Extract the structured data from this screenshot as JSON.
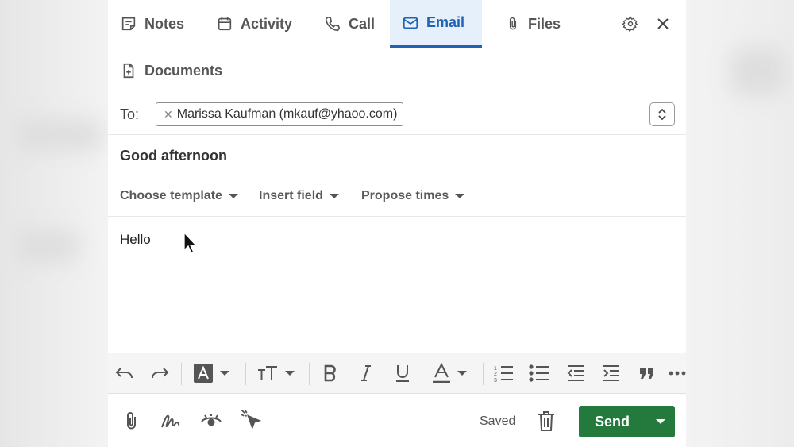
{
  "tabs": [
    {
      "label": "Notes",
      "icon": "notes-icon"
    },
    {
      "label": "Activity",
      "icon": "calendar-icon"
    },
    {
      "label": "Call",
      "icon": "phone-icon"
    },
    {
      "label": "Email",
      "icon": "mail-icon",
      "active": true
    },
    {
      "label": "Files",
      "icon": "paperclip-icon"
    }
  ],
  "documents_tab": {
    "label": "Documents",
    "icon": "document-icon"
  },
  "header_icons": [
    "gear-icon",
    "close-icon"
  ],
  "compose": {
    "to_label": "To:",
    "recipient": "Marissa Kaufman (mkauf@yhaoo.com)",
    "subject": "Good afternoon",
    "dropdowns": [
      "Choose template",
      "Insert field",
      "Propose times"
    ],
    "body": "Hello"
  },
  "toolbar_icons": [
    "undo-icon",
    "redo-icon",
    "highlight-icon",
    "text-size-icon",
    "bold-icon",
    "italic-icon",
    "underline-icon",
    "font-color-icon",
    "numbered-list-icon",
    "bullet-list-icon",
    "outdent-icon",
    "indent-icon",
    "quote-icon",
    "more-icon"
  ],
  "footer": {
    "icons": [
      "attach-icon",
      "signature-icon",
      "tracking-eye-icon",
      "click-tracking-icon",
      "trash-icon"
    ],
    "saved_label": "Saved",
    "send_label": "Send"
  },
  "colors": {
    "accent": "#1f63b5",
    "send": "#237a3c",
    "active_tab_bg": "#e6f0fb"
  }
}
